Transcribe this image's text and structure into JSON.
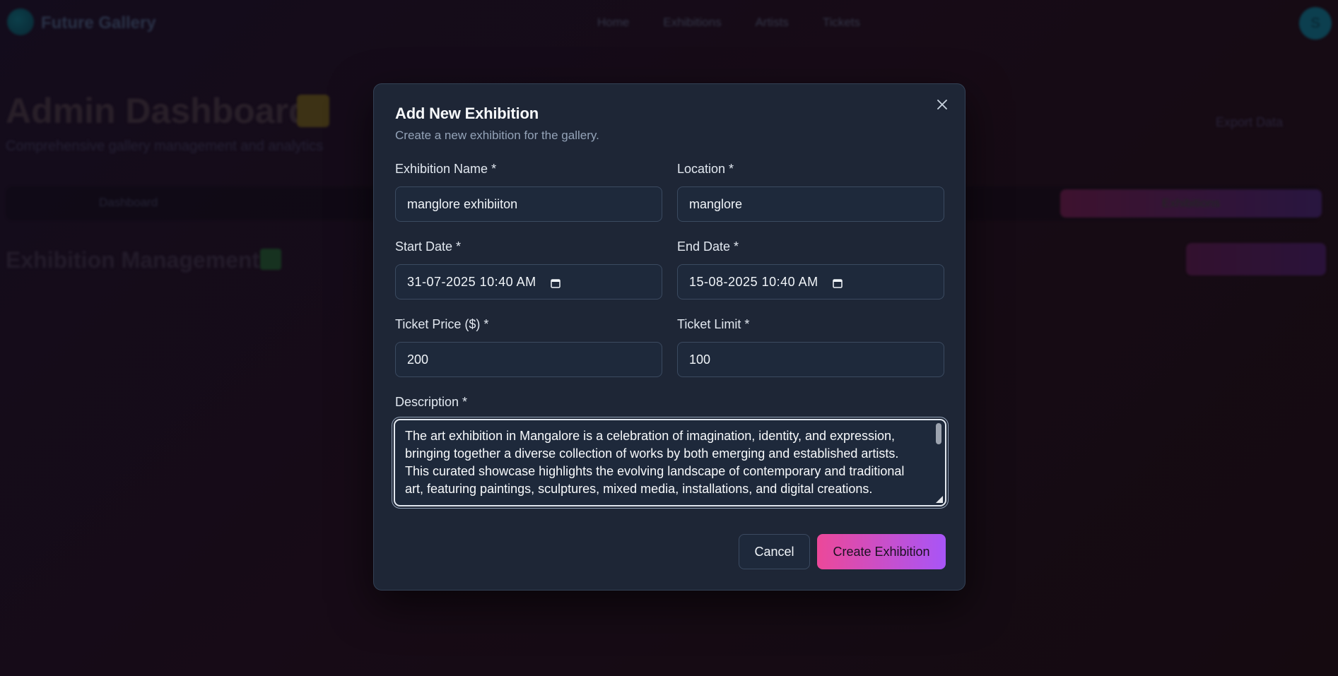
{
  "background": {
    "brand": "Future Gallery",
    "nav": [
      "Home",
      "Exhibitions",
      "Artists",
      "Tickets"
    ],
    "avatar_letter": "S",
    "dashboard_title": "Admin Dashboard",
    "dashboard_subtitle": "Comprehensive gallery management and analytics",
    "export_label": "Export Data",
    "tab_dashboard": "Dashboard",
    "tab_exhibitions": "Exhibitions",
    "section_title": "Exhibition Management"
  },
  "modal": {
    "title": "Add New Exhibition",
    "description": "Create a new exhibition for the gallery.",
    "fields": {
      "name": {
        "label": "Exhibition Name *",
        "value": "manglore exhibiiton"
      },
      "location": {
        "label": "Location *",
        "value": "manglore"
      },
      "start_date": {
        "label": "Start Date *",
        "value": "31-07-2025 10:40 AM"
      },
      "end_date": {
        "label": "End Date *",
        "value": "15-08-2025 10:40 AM"
      },
      "ticket_price": {
        "label": "Ticket Price ($) *",
        "value": "200"
      },
      "ticket_limit": {
        "label": "Ticket Limit *",
        "value": "100"
      },
      "description": {
        "label": "Description *",
        "value": "The art exhibition in Mangalore is a celebration of imagination, identity, and expression, bringing together a diverse collection of works by both emerging and established artists. This curated showcase highlights the evolving landscape of contemporary and traditional art, featuring paintings, sculptures, mixed media, installations, and digital creations."
      }
    },
    "cancel_label": "Cancel",
    "create_label": "Create Exhibition",
    "close_icon": "close-icon"
  },
  "colors": {
    "modal_bg": "#1e2636",
    "input_bg": "#1e293b",
    "accent_start": "#ec4899",
    "accent_end": "#a855f7"
  }
}
